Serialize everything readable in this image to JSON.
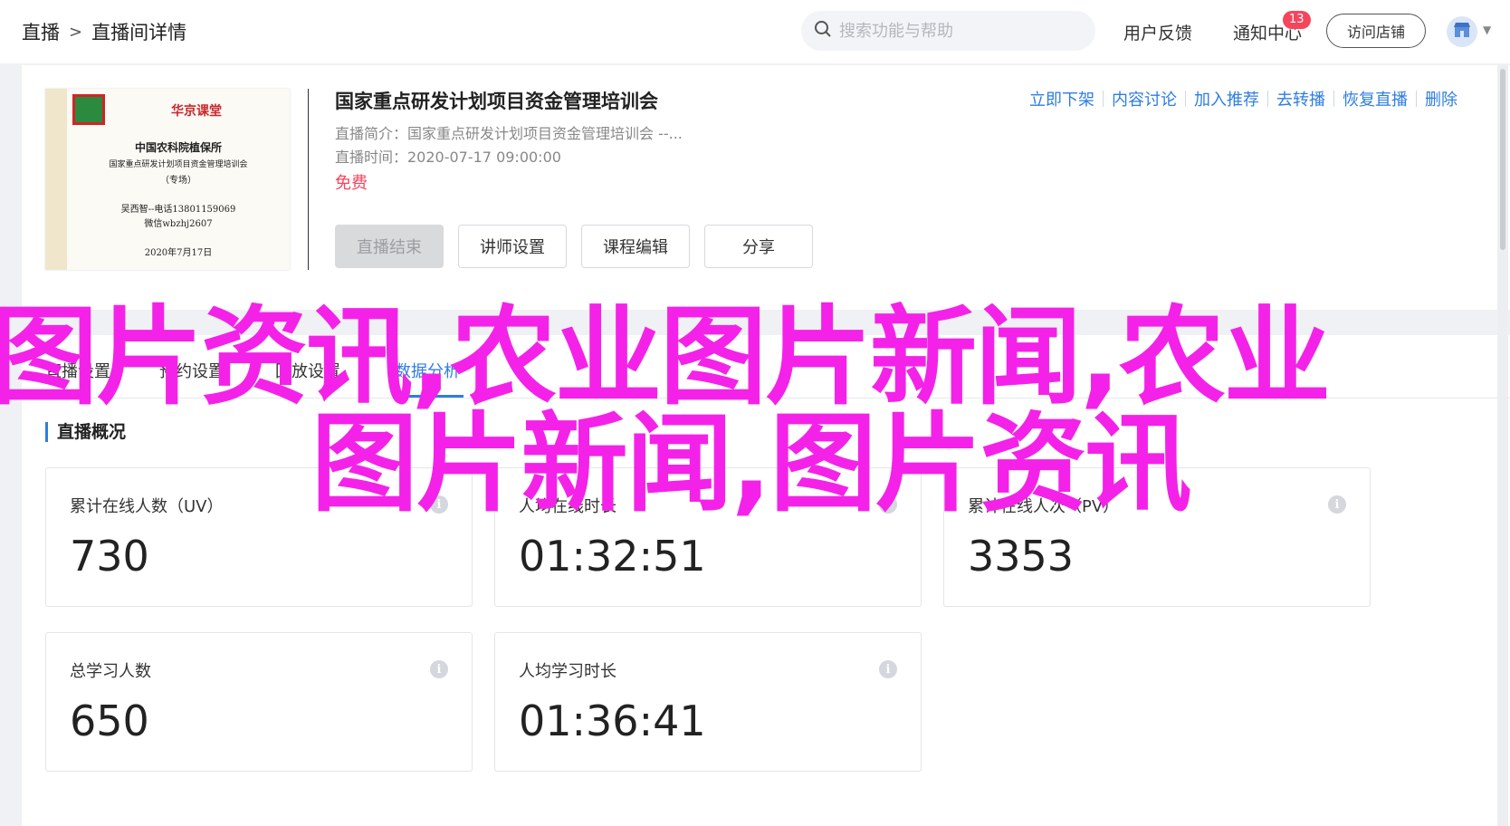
{
  "breadcrumb": {
    "root": "直播",
    "sep": ">",
    "current": "直播间详情"
  },
  "search": {
    "placeholder": "搜索功能与帮助"
  },
  "header": {
    "feedback": "用户反馈",
    "notice": "通知中心",
    "notice_count": "13",
    "visit_store": "访问店铺"
  },
  "course": {
    "title": "国家重点研发计划项目资金管理培训会",
    "intro": "直播简介：国家重点研发计划项目资金管理培训会 --...",
    "time": "直播时间：2020-07-17 09:00:00",
    "price": "免费",
    "cover": {
      "brand": "华京课堂",
      "org": "中国农科院植保所",
      "line1": "国家重点研发计划项目资金管理培训会",
      "line2": "（专场）",
      "contact1": "吴西智--电话13801159069",
      "contact2": "微信wbzhj2607",
      "date": "2020年7月17日"
    }
  },
  "buttons": {
    "end_live": "直播结束",
    "lecturer": "讲师设置",
    "edit_course": "课程编辑",
    "share": "分享"
  },
  "actions": [
    "立即下架",
    "内容讨论",
    "加入推荐",
    "去转播",
    "恢复直播",
    "删除"
  ],
  "tabs": [
    "直播设置",
    "预约设置",
    "回放设置",
    "数据分析"
  ],
  "active_tab": "数据分析",
  "section_title": "直播概况",
  "stats": [
    {
      "label": "累计在线人数（UV）",
      "value": "730"
    },
    {
      "label": "人均在线时长",
      "value": "01:32:51"
    },
    {
      "label": "累计在线人次（PV）",
      "value": "3353"
    },
    {
      "label": "总学习人数",
      "value": "650"
    },
    {
      "label": "人均学习时长",
      "value": "01:36:41"
    }
  ],
  "overlay": {
    "line1": "图片资讯,农业图片新闻,农业",
    "line2": "图片新闻,图片资讯"
  },
  "colors": {
    "accent": "#2f7de1",
    "price": "#f5455c",
    "overlay": "#f422e8"
  }
}
